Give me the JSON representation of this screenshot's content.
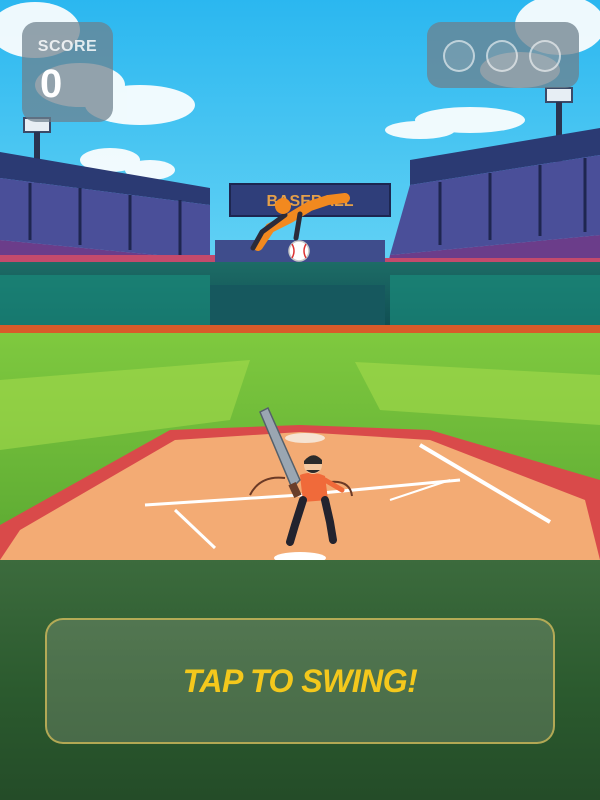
{
  "hud": {
    "score_label": "SCORE",
    "score_value": "0",
    "lives_total": 3
  },
  "scene": {
    "scoreboard_text": "BASEBALL",
    "description_icons": [
      "batter-icon",
      "pitcher-icon",
      "baseball-icon",
      "bat-icon"
    ]
  },
  "action": {
    "swing_label": "TAP TO SWING!"
  },
  "colors": {
    "accent": "#f4c81c",
    "field_green": "#6fbf3a",
    "dirt": "#f2a971",
    "sky": "#3ec5f3"
  }
}
